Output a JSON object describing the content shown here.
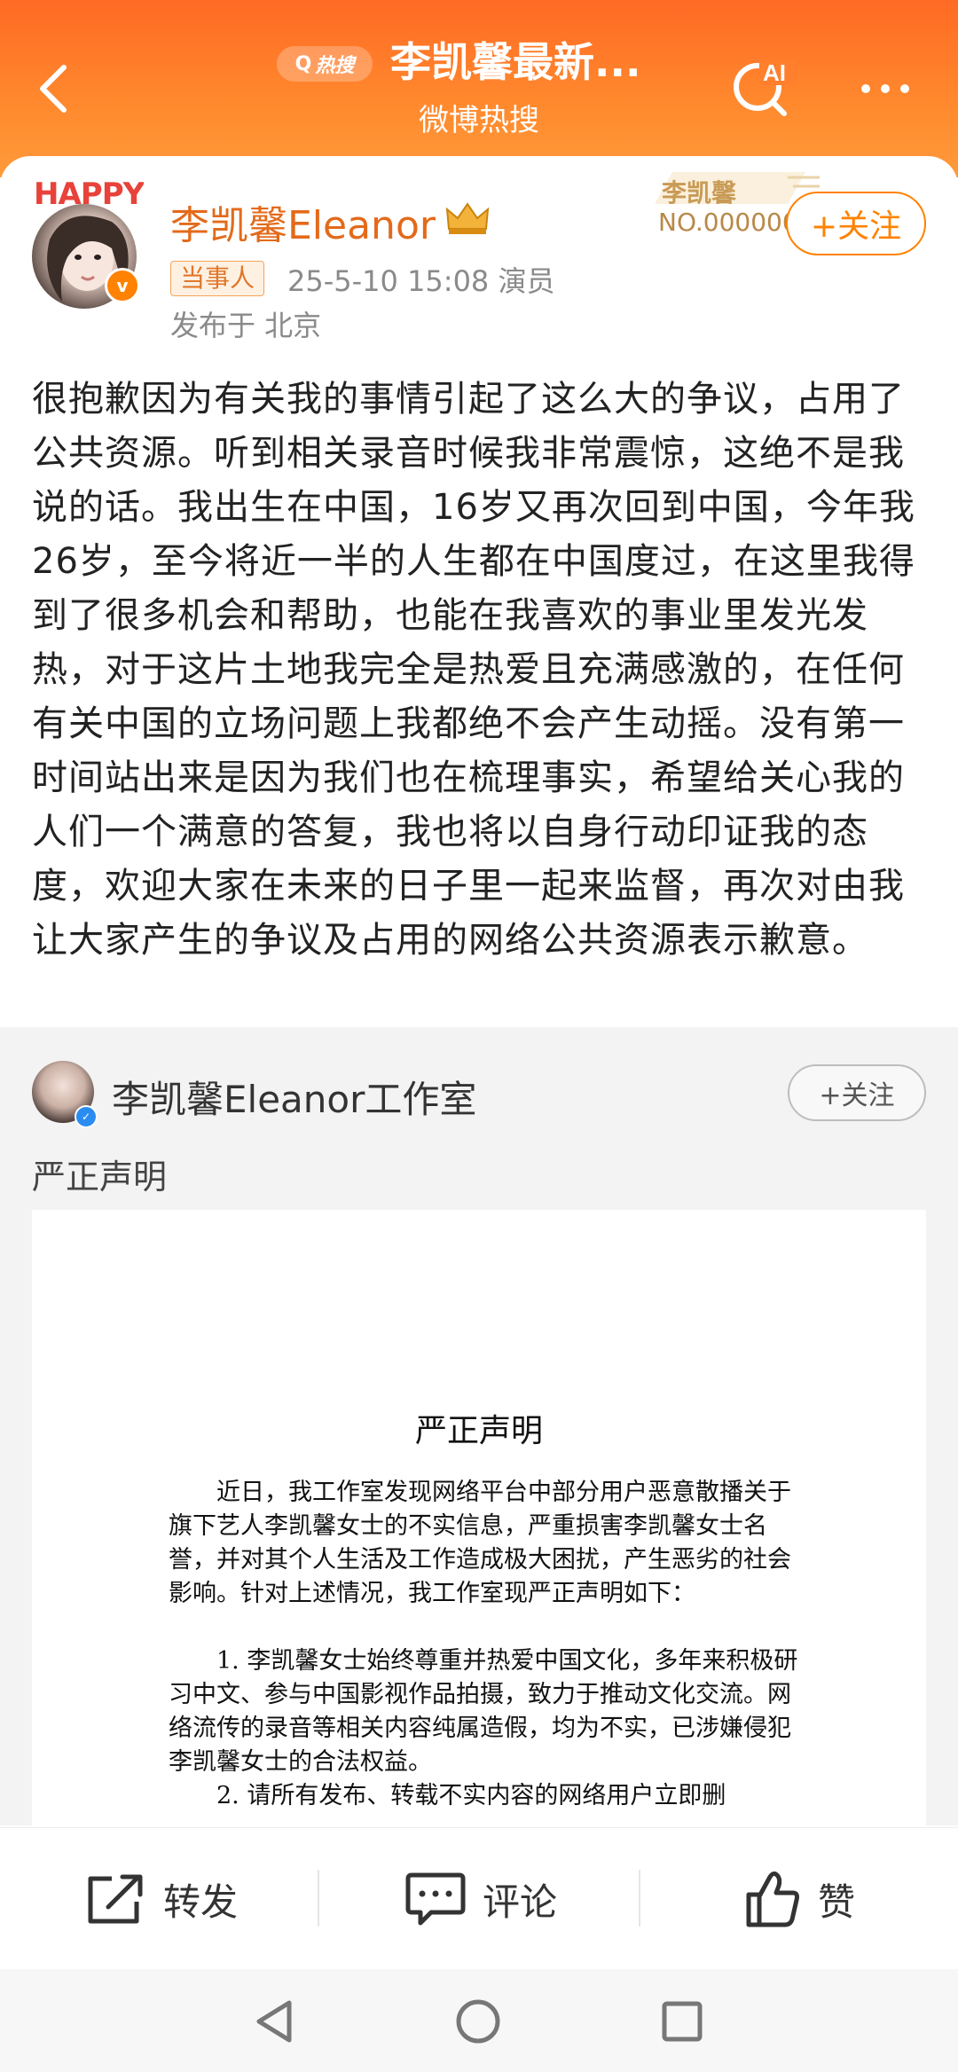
{
  "header": {
    "hot_badge_label": "热搜",
    "title": "李凯馨最新...",
    "subtitle": "微博热搜",
    "ai_label": "AI"
  },
  "post": {
    "avatar_overlay": "HAPPY",
    "author_name": "李凯馨Eleanor",
    "fan_badge_name": "李凯馨",
    "fan_badge_number": "NO.000000",
    "follow_label": "+关注",
    "role_tag": "当事人",
    "time_and_source": "25-5-10 15:08  演员",
    "location": "发布于 北京",
    "body": "很抱歉因为有关我的事情引起了这么大的争议，占用了公共资源。听到相关录音时候我非常震惊，这绝不是我说的话。我出生在中国，16岁又再次回到中国，今年我26岁，至今将近一半的人生都在中国度过，在这里我得到了很多机会和帮助，也能在我喜欢的事业里发光发热，对于这片土地我完全是热爱且充满感激的，在任何有关中国的立场问题上我都绝不会产生动摇。没有第一时间站出来是因为我们也在梳理事实，希望给关心我的人们一个满意的答复，我也将以自身行动印证我的态度，欢迎大家在未来的日子里一起来监督，再次对由我让大家产生的争议及占用的网络公共资源表示歉意。"
  },
  "repost": {
    "author_name": "李凯馨Eleanor工作室",
    "follow_label": "+关注",
    "title": "严正声明",
    "document": {
      "title": "严正声明",
      "intro": "近日，我工作室发现网络平台中部分用户恶意散播关于旗下艺人李凯馨女士的不实信息，严重损害李凯馨女士名誉，并对其个人生活及工作造成极大困扰，产生恶劣的社会影响。针对上述情况，我工作室现严正声明如下：",
      "item1": "1. 李凯馨女士始终尊重并热爱中国文化，多年来积极研习中文、参与中国影视作品拍摄，致力于推动文化交流。网络流传的录音等相关内容纯属造假，均为不实，已涉嫌侵犯李凯馨女士的合法权益。",
      "item2": "2. 请所有发布、转载不实内容的网络用户立即删"
    }
  },
  "actions": {
    "repost_label": "转发",
    "comment_label": "评论",
    "like_label": "赞"
  },
  "colors": {
    "header_orange": "#ff7a28",
    "accent_orange": "#ff8200",
    "name_orange": "#e36a1a"
  }
}
